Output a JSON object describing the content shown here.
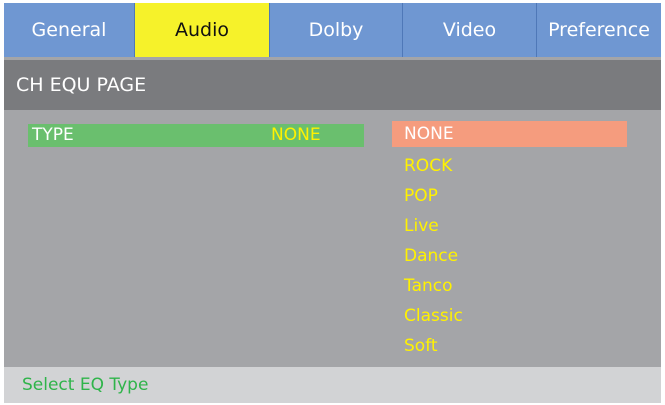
{
  "tabs": [
    {
      "label": "General",
      "active": false
    },
    {
      "label": "Audio",
      "active": true
    },
    {
      "label": "Dolby",
      "active": false
    },
    {
      "label": "Video",
      "active": false
    },
    {
      "label": "Preference",
      "active": false
    }
  ],
  "page": {
    "title": "CH EQU PAGE"
  },
  "setting": {
    "label": "TYPE",
    "value": "NONE"
  },
  "options": [
    {
      "label": "NONE",
      "selected": true
    },
    {
      "label": "ROCK",
      "selected": false
    },
    {
      "label": "POP",
      "selected": false
    },
    {
      "label": "Live",
      "selected": false
    },
    {
      "label": "Dance",
      "selected": false
    },
    {
      "label": "Tanco",
      "selected": false
    },
    {
      "label": "Classic",
      "selected": false
    },
    {
      "label": "Soft",
      "selected": false
    }
  ],
  "status": {
    "text": "Select EQ Type"
  },
  "colors": {
    "tab": "#6f97d2",
    "tab_active": "#f6f22a",
    "panel": "#a4a5a8",
    "header": "#7a7b7e",
    "type_row": "#6abf6e",
    "option_text": "#fff200",
    "option_selected": "#f59c7e",
    "status_bar": "#d2d3d5",
    "status_text": "#2fb44a"
  }
}
